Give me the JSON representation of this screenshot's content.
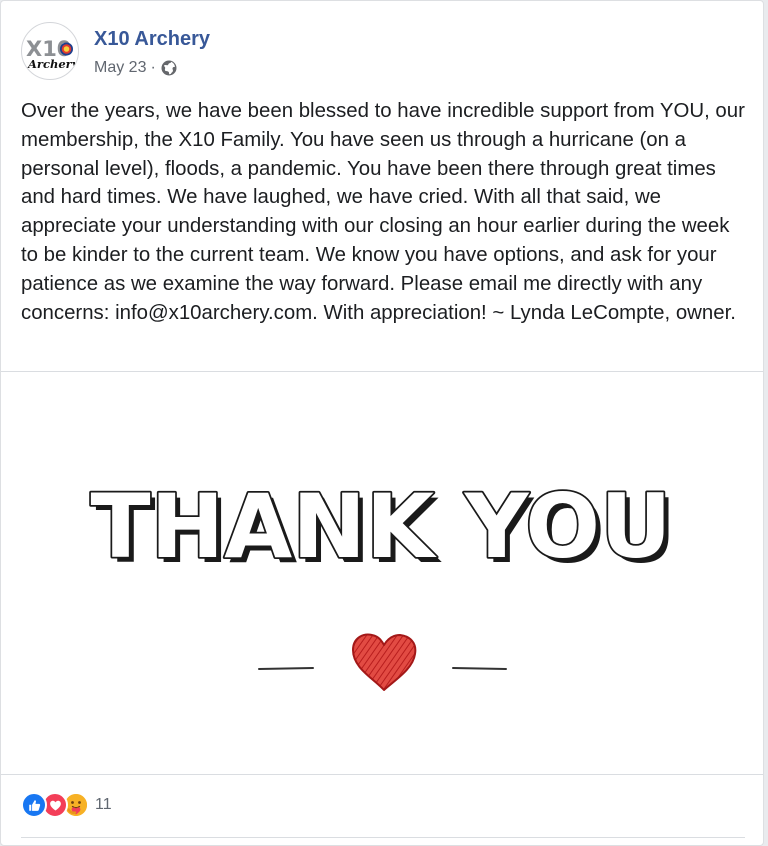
{
  "post": {
    "author": "X10 Archery",
    "date": "May 23",
    "separator": "·",
    "privacy_icon": "globe-icon",
    "body": "Over the years, we have been blessed to have incredible support from YOU, our membership, the X10 Family. You have seen us through a hurricane (on a personal level), floods, a pandemic. You have been there through great times and hard times. We have laughed, we have cried. With all that said, we appreciate your understanding with our closing an hour earlier during the week to be kinder to the current team. We know you have options, and ask for your patience as we examine the way forward. Please email me directly with any concerns: info@x10archery.com. With appreciation! ~ Lynda LeCompte, owner."
  },
  "avatar": {
    "logo_text": "X10",
    "logo_script": "Archery"
  },
  "image": {
    "headline": "THANK YOU",
    "heart_color": "#d9312b"
  },
  "reactions": {
    "icons": [
      "like-icon",
      "love-icon",
      "care-icon"
    ],
    "count": "11"
  },
  "colors": {
    "link": "#385898",
    "text": "#1c1e21",
    "meta": "#616770"
  }
}
